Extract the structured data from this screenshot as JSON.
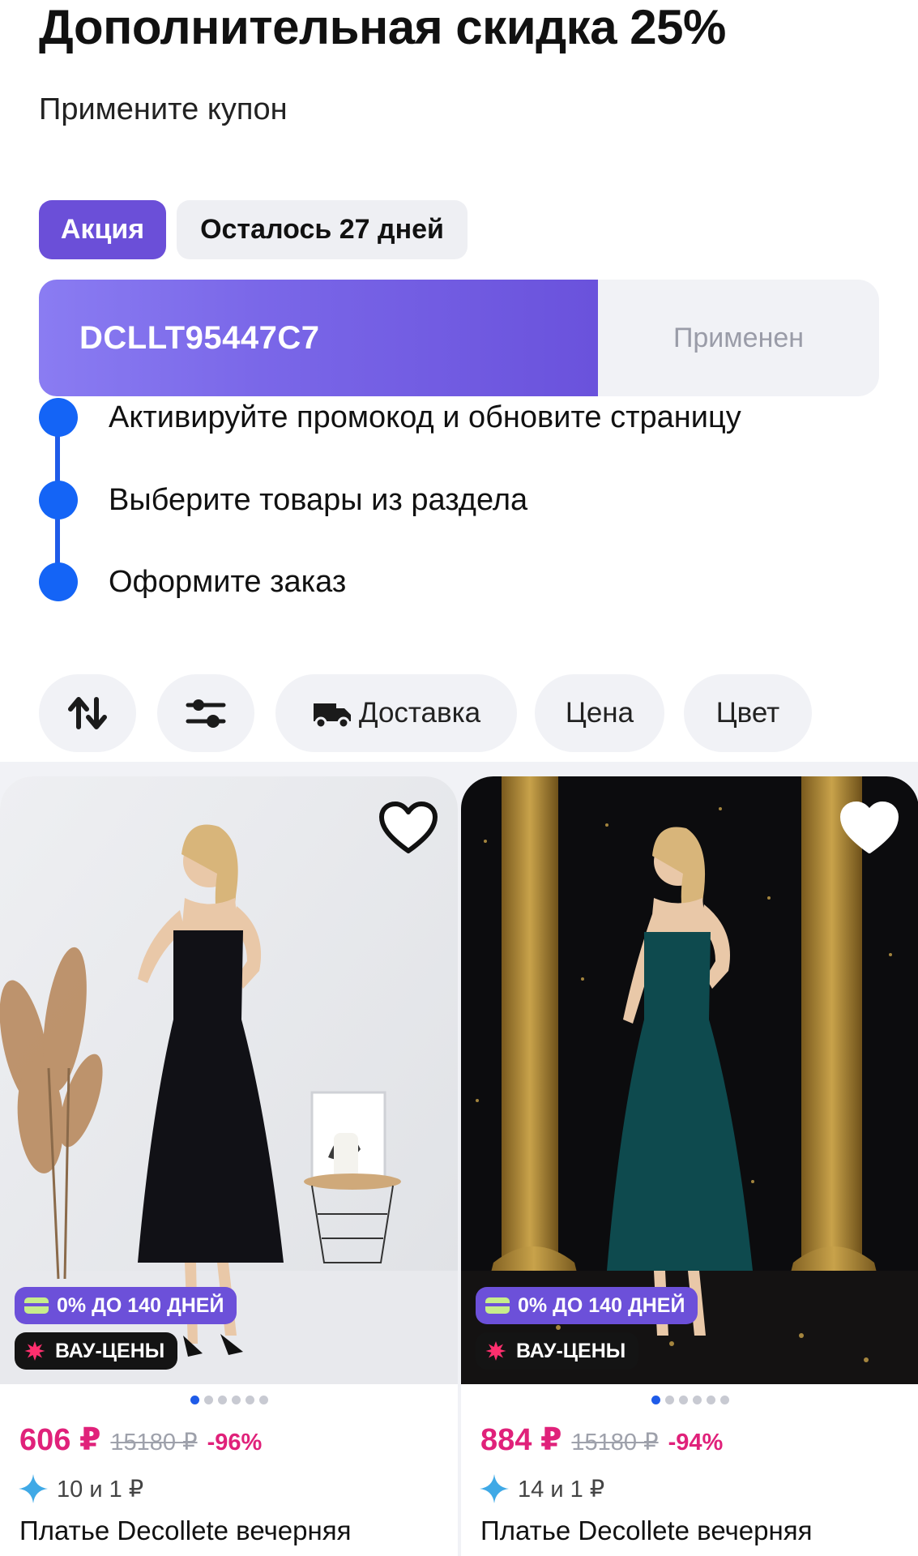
{
  "header": {
    "title": "Дополнительная скидка 25%",
    "subtitle": "Примените купон"
  },
  "chips": {
    "promo": "Акция",
    "days_left": "Осталось 27 дней"
  },
  "coupon": {
    "code": "DCLLT95447C7",
    "status": "Применен",
    "gradient_start": "#8a7cf2",
    "gradient_end": "#6a52dc"
  },
  "steps": [
    {
      "text": "Активируйте промокод и обновите страницу"
    },
    {
      "text": "Выберите товары из раздела"
    },
    {
      "text": "Оформите заказ"
    }
  ],
  "filters": {
    "sort_icon": "sort-arrows-icon",
    "settings_icon": "sliders-icon",
    "delivery": "Доставка",
    "price": "Цена",
    "color": "Цвет"
  },
  "products": [
    {
      "badge_credit": "0% ДО 140 ДНЕЙ",
      "badge_wow": "ВАУ-ЦЕНЫ",
      "price": "606 ₽",
      "old_price": "15180 ₽",
      "discount": "-96%",
      "bonus": "10 и 1 ₽",
      "name": "Платье Decollete вечерняя",
      "dress_color": "#101015",
      "image_count": 6,
      "active_image": 1
    },
    {
      "badge_credit": "0% ДО 140 ДНЕЙ",
      "badge_wow": "ВАУ-ЦЕНЫ",
      "price": "884 ₽",
      "old_price": "15180 ₽",
      "discount": "-94%",
      "bonus": "14 и 1 ₽",
      "name": "Платье Decollete вечерняя",
      "dress_color": "#0e4a4e",
      "image_count": 6,
      "active_image": 1
    }
  ],
  "colors": {
    "accent_purple": "#6b4fd8",
    "step_blue": "#1464f6",
    "price_pink": "#e0217a"
  }
}
